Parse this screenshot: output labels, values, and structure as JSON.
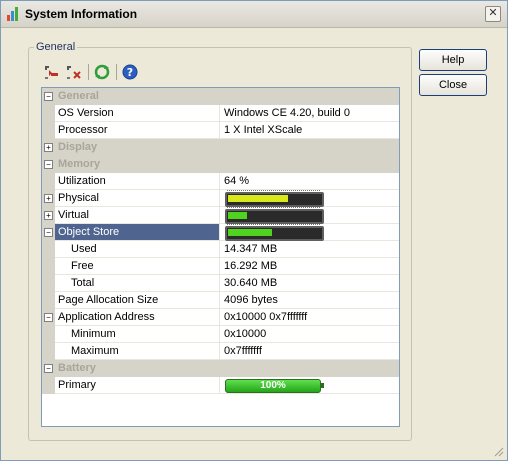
{
  "window": {
    "title": "System Information"
  },
  "group": {
    "label": "General"
  },
  "toolbar": {
    "icons": [
      "expand-all-icon",
      "collapse-all-icon",
      "refresh-icon",
      "help-icon"
    ]
  },
  "buttons": {
    "help": "Help",
    "close": "Close"
  },
  "categories": {
    "general": "General",
    "display": "Display",
    "memory": "Memory",
    "battery": "Battery"
  },
  "rows": {
    "os_version": {
      "name": "OS Version",
      "value": "Windows CE 4.20, build 0"
    },
    "processor": {
      "name": "Processor",
      "value": "1 X Intel XScale"
    },
    "utilization": {
      "name": "Utilization",
      "value": "64 %"
    },
    "physical": {
      "name": "Physical",
      "level": 0.64
    },
    "virtual": {
      "name": "Virtual",
      "level": 0.2
    },
    "object_store": {
      "name": "Object Store",
      "level": 0.47
    },
    "used": {
      "name": "Used",
      "value": "14.347 MB"
    },
    "free": {
      "name": "Free",
      "value": "16.292 MB"
    },
    "total": {
      "name": "Total",
      "value": "30.640 MB"
    },
    "page_alloc": {
      "name": "Page Allocation Size",
      "value": "4096 bytes"
    },
    "app_addr": {
      "name": "Application Address",
      "value": "0x10000 0x7fffffff"
    },
    "minimum": {
      "name": "Minimum",
      "value": "0x10000"
    },
    "maximum": {
      "name": "Maximum",
      "value": "0x7fffffff"
    },
    "primary": {
      "name": "Primary",
      "value": "100%",
      "level": 1.0
    }
  },
  "colors": {
    "bar_fill_green": "#4fd31f",
    "bar_fill_yellow": "#d8e81a",
    "selection": "#4f6590"
  }
}
